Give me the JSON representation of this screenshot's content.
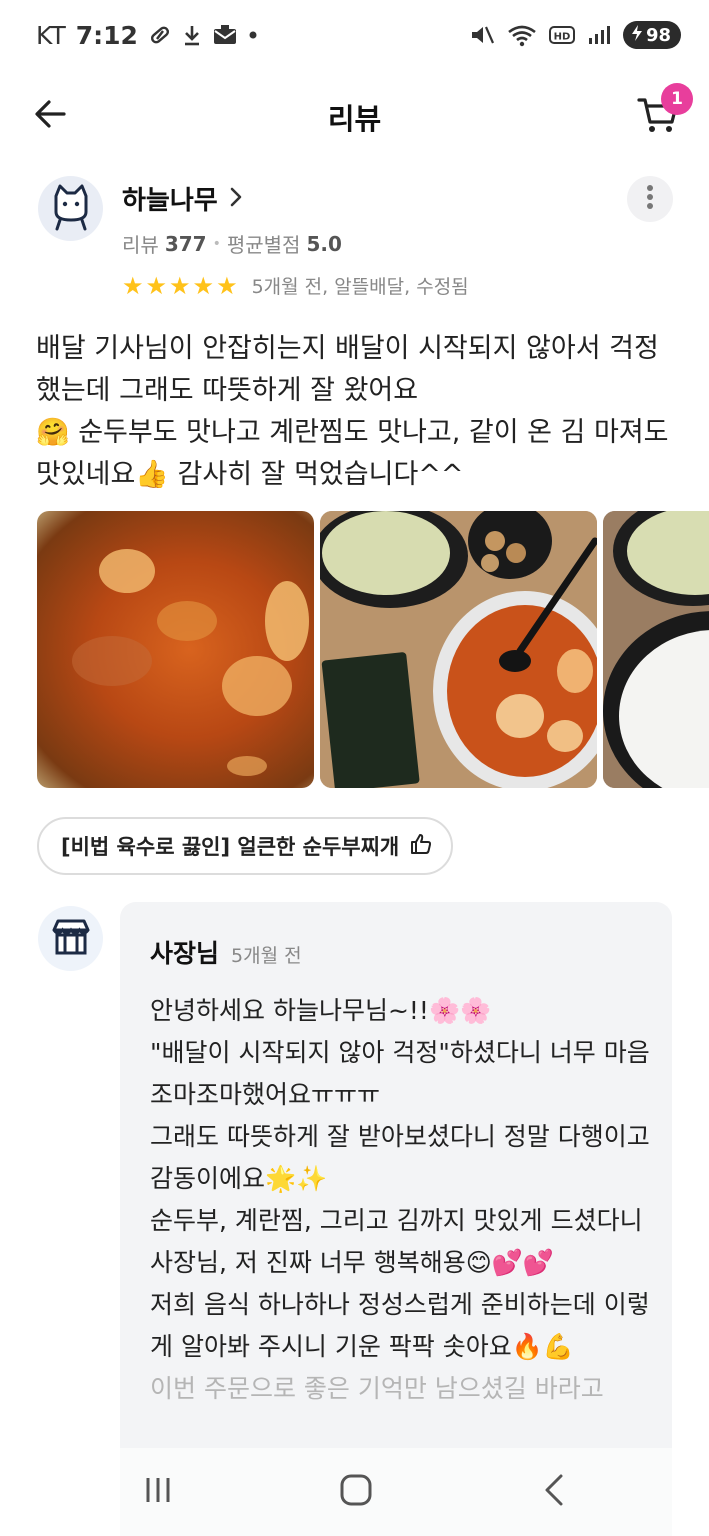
{
  "status_bar": {
    "carrier": "KT",
    "time": "7:12",
    "battery": "98"
  },
  "header": {
    "title": "리뷰",
    "cart_count": "1"
  },
  "reviewer": {
    "name": "하늘나무",
    "review_label": "리뷰",
    "review_count": "377",
    "avg_label": "평균별점",
    "avg_rating": "5.0",
    "rating": 5,
    "review_info": "5개월 전, 알뜰배달, 수정됨"
  },
  "review": {
    "line1": "배달 기사님이 안잡히는지 배달이 시작되지 않아서 걱정했는데 그래도 따뜻하게 잘 왔어요",
    "line2": "🤗 순두부도 맛나고 계란찜도 맛나고, 같이 온 김 마져도 맛있네요👍 감사히 잘 먹었습니다^^"
  },
  "menu_tag": {
    "label": "[비법 육수로 끓인] 얼큰한 순두부찌개"
  },
  "owner_reply": {
    "author": "사장님",
    "time": "5개월 전",
    "lines": [
      "안녕하세요 하늘나무님~!!🌸🌸",
      "\"배달이 시작되지 않아 걱정\"하셨다니 너무 마음 조마조마했어요ㅠㅠㅠ",
      "그래도 따뜻하게 잘 받아보셨다니 정말 다행이고 감동이에요🌟✨",
      "순두부, 계란찜, 그리고 김까지 맛있게 드셨다니 사장님, 저 진짜 너무 행복해용😊💕💕",
      "저희 음식 하나하나 정성스럽게 준비하는데 이렇게 알아봐 주시니 기운 팍팍 솟아요🔥💪",
      "이번 주문으로 좋은 기억만 남으셨길 바라고"
    ]
  },
  "icons": {
    "back": "arrow-left-icon",
    "cart": "cart-icon",
    "more": "more-vertical-icon",
    "chevron": "chevron-right-icon",
    "thumbs_up": "thumbs-up-icon",
    "store": "store-icon"
  },
  "colors": {
    "accent": "#e83e9c",
    "star": "#ffc21a",
    "reply_bg": "#f3f4f6"
  }
}
